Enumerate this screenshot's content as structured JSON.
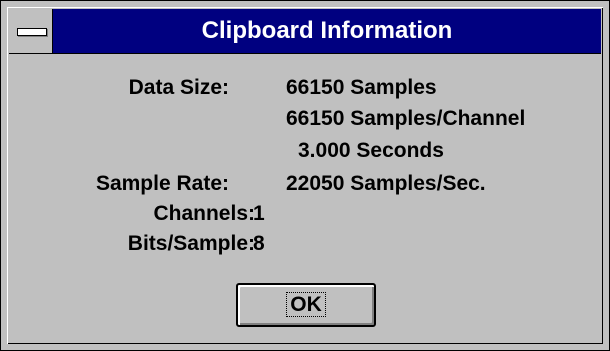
{
  "window": {
    "title": "Clipboard Information"
  },
  "info": {
    "data_size_label": "Data Size:",
    "data_size_samples": "66150 Samples",
    "data_size_per_channel": "66150 Samples/Channel",
    "data_size_seconds": "3.000 Seconds",
    "sample_rate_label": "Sample Rate:",
    "sample_rate_value": "22050 Samples/Sec.",
    "channels_label": "Channels:",
    "channels_value": "1",
    "bits_label": "Bits/Sample:",
    "bits_value": "8"
  },
  "buttons": {
    "ok_label": "OK"
  },
  "colors": {
    "titlebar": "#000080",
    "face": "#c0c0c0"
  },
  "icons": {
    "system_menu": "system-menu-icon"
  }
}
